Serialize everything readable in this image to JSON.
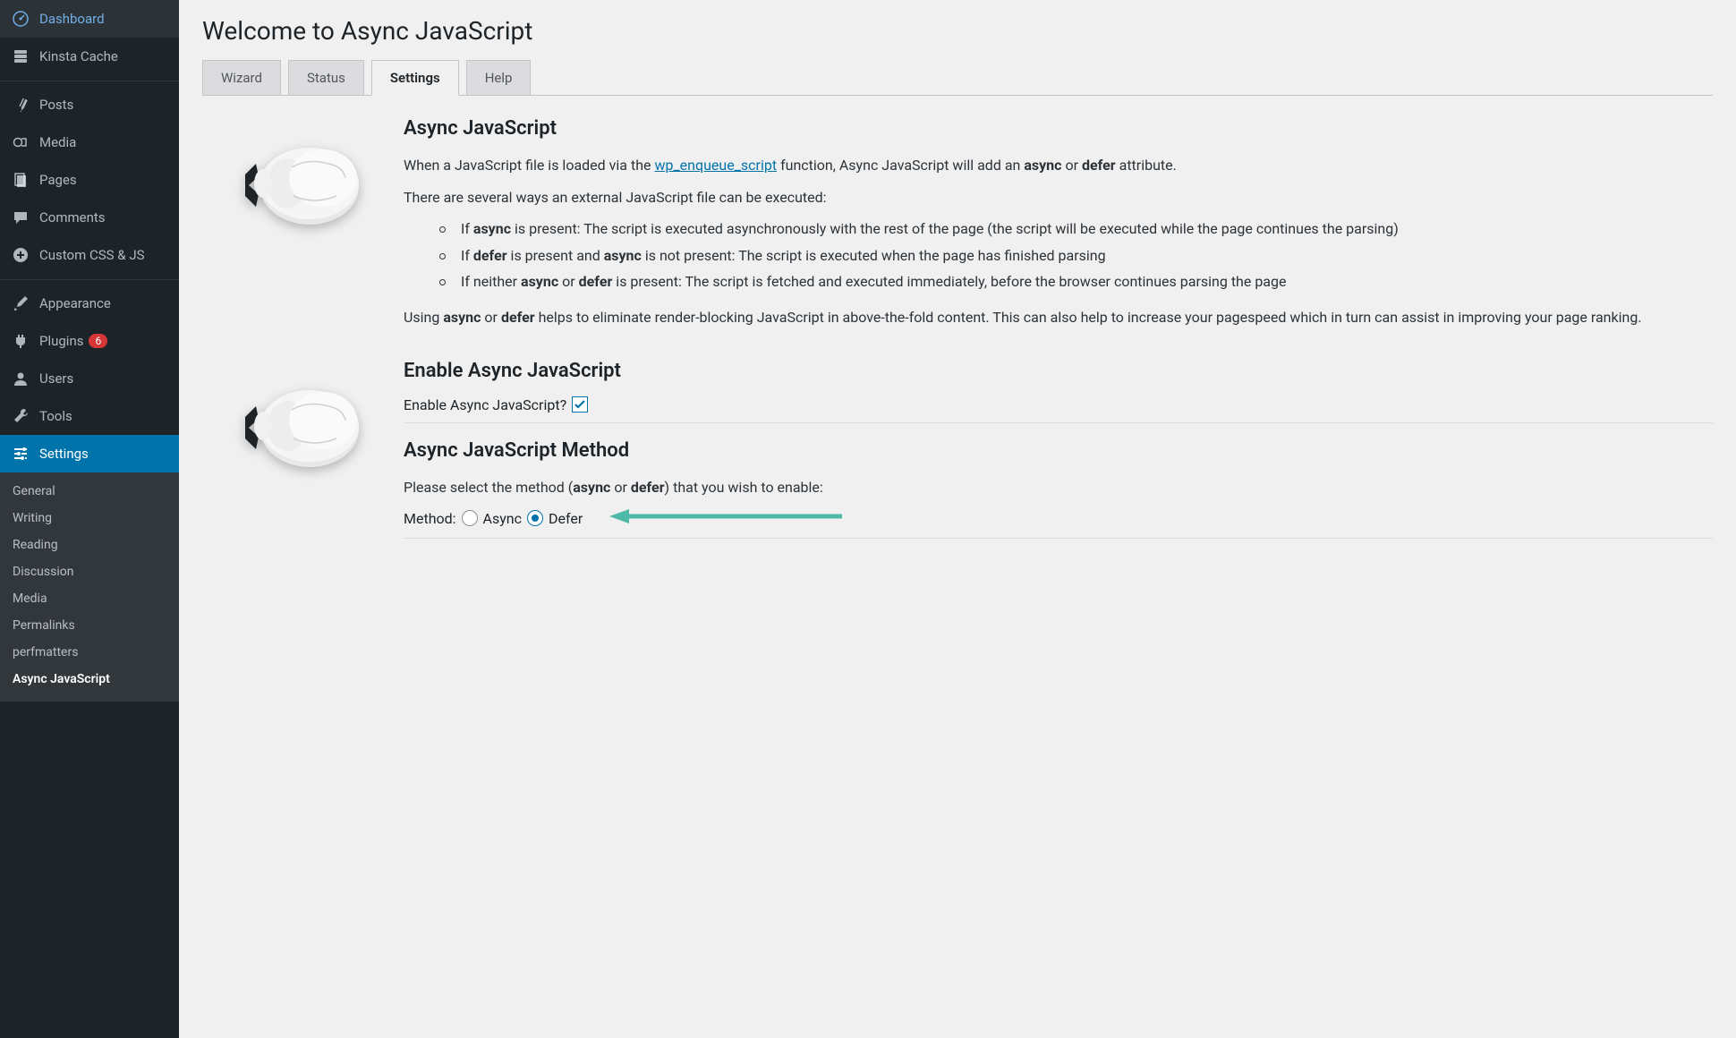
{
  "sidebar": {
    "items": [
      {
        "label": "Dashboard"
      },
      {
        "label": "Kinsta Cache"
      },
      {
        "label": "Posts"
      },
      {
        "label": "Media"
      },
      {
        "label": "Pages"
      },
      {
        "label": "Comments"
      },
      {
        "label": "Custom CSS & JS"
      },
      {
        "label": "Appearance"
      },
      {
        "label": "Plugins",
        "badge": "6"
      },
      {
        "label": "Users"
      },
      {
        "label": "Tools"
      },
      {
        "label": "Settings"
      }
    ],
    "submenu": [
      "General",
      "Writing",
      "Reading",
      "Discussion",
      "Media",
      "Permalinks",
      "perfmatters",
      "Async JavaScript"
    ]
  },
  "page": {
    "title": "Welcome to Async JavaScript",
    "tabs": [
      "Wizard",
      "Status",
      "Settings",
      "Help"
    ]
  },
  "section1": {
    "heading": "Async JavaScript",
    "p1a": "When a JavaScript file is loaded via the ",
    "link": "wp_enqueue_script",
    "p1b": " function, Async JavaScript will add an ",
    "p1c": " or ",
    "p1d": " attribute.",
    "p2": "There are several ways an external JavaScript file can be executed:",
    "li1a": "If ",
    "li1b": " is present: The script is executed asynchronously with the rest of the page (the script will be executed while the page continues the parsing)",
    "li2a": "If ",
    "li2b": " is present and ",
    "li2c": " is not present: The script is executed when the page has finished parsing",
    "li3a": "If neither ",
    "li3b": " or ",
    "li3c": " is present: The script is fetched and executed immediately, before the browser continues parsing the page",
    "p3a": "Using ",
    "p3b": " or ",
    "p3c": " helps to eliminate render-blocking JavaScript in above-the-fold content. This can also help to increase your pagespeed which in turn can assist in improving your page ranking.",
    "async": "async",
    "defer": "defer"
  },
  "section2": {
    "heading": "Enable Async JavaScript",
    "label": "Enable Async JavaScript? "
  },
  "section3": {
    "heading": "Async JavaScript Method",
    "p1a": "Please select the method (",
    "p1b": " or ",
    "p1c": ") that you wish to enable:",
    "methodLabel": "Method: ",
    "opt1": "Async",
    "opt2": "Defer",
    "async": "async",
    "defer": "defer"
  }
}
